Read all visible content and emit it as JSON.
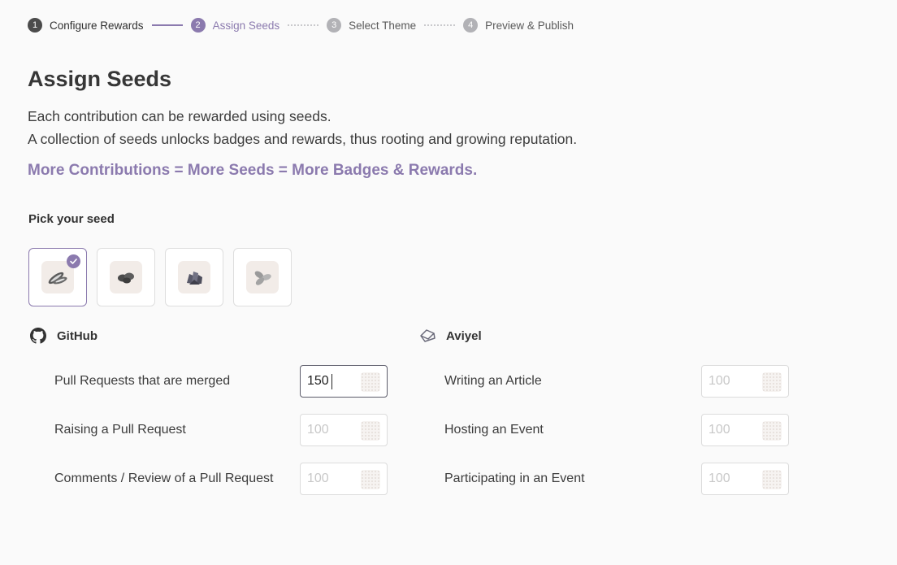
{
  "stepper": {
    "steps": [
      {
        "num": "1",
        "label": "Configure Rewards"
      },
      {
        "num": "2",
        "label": "Assign Seeds"
      },
      {
        "num": "3",
        "label": "Select Theme"
      },
      {
        "num": "4",
        "label": "Preview & Publish"
      }
    ],
    "active_step": 2
  },
  "page": {
    "title": "Assign Seeds",
    "description_line1": "Each contribution can be rewarded using seeds.",
    "description_line2": "A collection of seeds unlocks badges and rewards, thus rooting and growing reputation.",
    "tagline": "More Contributions = More Seeds = More Badges & Rewards."
  },
  "seed_picker": {
    "label": "Pick your seed",
    "options": [
      {
        "icon": "sunflower-seed-icon",
        "selected": true
      },
      {
        "icon": "coffee-bean-icon",
        "selected": false
      },
      {
        "icon": "crystal-seed-icon",
        "selected": false
      },
      {
        "icon": "pumpkin-seed-icon",
        "selected": false
      }
    ]
  },
  "github": {
    "title": "GitHub",
    "icon": "github-icon",
    "rows": [
      {
        "label": "Pull Requests that are merged",
        "value": "150",
        "placeholder": "100"
      },
      {
        "label": "Raising a Pull Request",
        "value": "",
        "placeholder": "100"
      },
      {
        "label": "Comments / Review of a Pull Request",
        "value": "",
        "placeholder": "100"
      }
    ]
  },
  "aviyel": {
    "title": "Aviyel",
    "icon": "aviyel-logo-icon",
    "rows": [
      {
        "label": "Writing an Article",
        "value": "",
        "placeholder": "100"
      },
      {
        "label": "Hosting an Event",
        "value": "",
        "placeholder": "100"
      },
      {
        "label": "Participating in an Event",
        "value": "",
        "placeholder": "100"
      }
    ]
  },
  "colors": {
    "accent": "#8b7aae",
    "done_step": "#4b4b4b",
    "todo_step": "#b2b2b6",
    "background": "#fafafa"
  }
}
